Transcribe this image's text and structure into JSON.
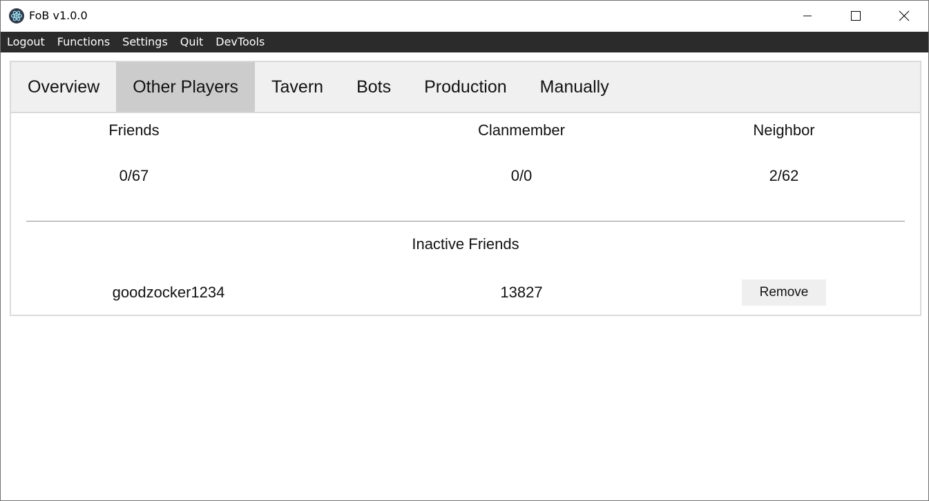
{
  "window": {
    "title": "FoB v1.0.0",
    "icon": "electron-atom-icon"
  },
  "menu": {
    "items": [
      "Logout",
      "Functions",
      "Settings",
      "Quit",
      "DevTools"
    ]
  },
  "tabs": {
    "items": [
      "Overview",
      "Other Players",
      "Tavern",
      "Bots",
      "Production",
      "Manually"
    ],
    "active": "Other Players"
  },
  "stats": {
    "friends_label": "Friends",
    "friends_value": "0/67",
    "clan_label": "Clanmember",
    "clan_value": "0/0",
    "neighbor_label": "Neighbor",
    "neighbor_value": "2/62"
  },
  "inactive": {
    "title": "Inactive Friends",
    "rows": [
      {
        "name": "goodzocker1234",
        "value": "13827",
        "action": "Remove"
      }
    ]
  },
  "colors": {
    "menubar": "#2b2b2b",
    "tabbar": "#f0f0f0",
    "active_tab": "#cccccc",
    "button": "#efefef"
  }
}
